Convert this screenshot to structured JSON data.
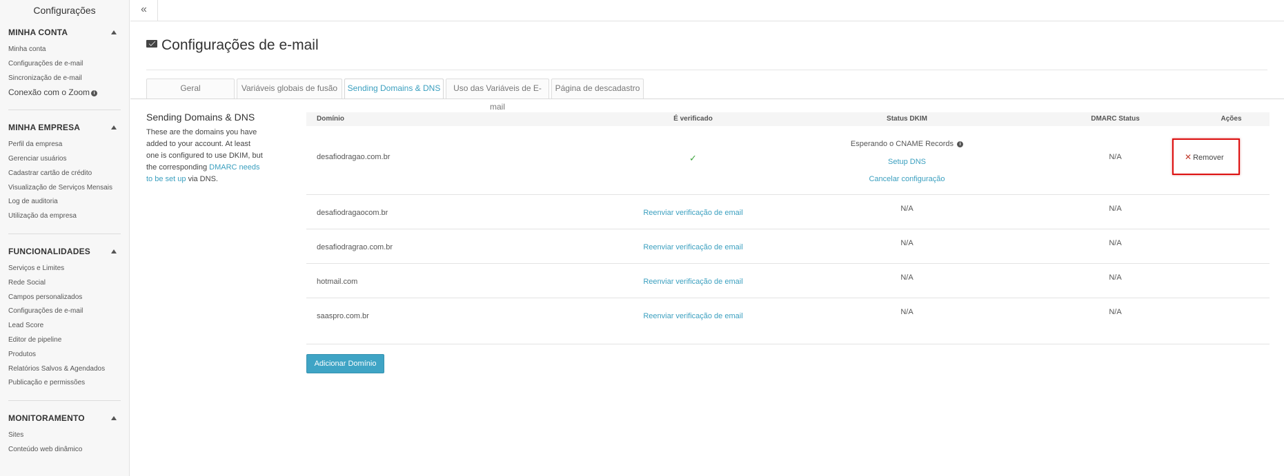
{
  "sidebar": {
    "title": "Configurações",
    "sections": {
      "minha_conta": {
        "header": "MINHA CONTA",
        "items": [
          "Minha conta",
          "Configurações de e-mail",
          "Sincronização de e-mail",
          "Conexão com o Zoom"
        ]
      },
      "minha_empresa": {
        "header": "MINHA EMPRESA",
        "items": [
          "Perfil da empresa",
          "Gerenciar usuários",
          "Cadastrar cartão de crédito",
          "Visualização de Serviços Mensais",
          "Log de auditoria",
          "Utilização da empresa"
        ]
      },
      "funcionalidades": {
        "header": "FUNCIONALIDADES",
        "items": [
          "Serviços e Limites",
          "Rede Social",
          "Campos personalizados",
          "Configurações de e-mail",
          "Lead Score",
          "Editor de pipeline",
          "Produtos",
          "Relatórios Salvos & Agendados",
          "Publicação e permissões"
        ]
      },
      "monitoramento": {
        "header": "MONITORAMENTO",
        "items": [
          "Sites",
          "Conteúdo web dinâmico"
        ]
      }
    }
  },
  "topbar": {
    "collapse_icon": "«"
  },
  "page": {
    "title": "Configurações de e-mail",
    "tabs": [
      "Geral",
      "Variáveis globais de fusão",
      "Sending Domains & DNS",
      "Uso das Variáveis de E-mail",
      "Página de descadastro"
    ],
    "active_tab": "Sending Domains & DNS"
  },
  "description": {
    "title": "Sending Domains & DNS",
    "text_before": "These are the domains you have added to your account. At least one is configured to use DKIM, but the corresponding",
    "link": "DMARC needs to be set up",
    "text_after": "via DNS."
  },
  "table": {
    "headers": [
      "Domínio",
      "É verificado",
      "Status DKIM",
      "DMARC Status",
      "Ações"
    ],
    "rows": [
      {
        "domain": "desafiodragao.com.br",
        "verified": "✓",
        "dkim_status": "Esperando o CNAME Records",
        "dkim_setup": "Setup DNS",
        "dkim_cancel": "Cancelar configuração",
        "dmarc": "N/A",
        "action": "Remover"
      },
      {
        "domain": "desafiodragaocom.br",
        "verified": "Reenviar verificação de email",
        "dkim_status": "N/A",
        "dmarc": "N/A"
      },
      {
        "domain": "desafiodragrao.com.br",
        "verified": "Reenviar verificação de email",
        "dkim_status": "N/A",
        "dmarc": "N/A"
      },
      {
        "domain": "hotmail.com",
        "verified": "Reenviar verificação de email",
        "dkim_status": "N/A",
        "dmarc": "N/A"
      },
      {
        "domain": "saaspro.com.br",
        "verified": "Reenviar verificação de email",
        "dkim_status": "N/A",
        "dmarc": "N/A"
      }
    ]
  },
  "add_domain_button": "Adicionar Domínio",
  "colors": {
    "accent": "#3a9fbf",
    "button": "#3fa4c5",
    "highlight_box": "#dd0f0f",
    "check": "#3ea53e",
    "remove_x": "#c0392b"
  }
}
